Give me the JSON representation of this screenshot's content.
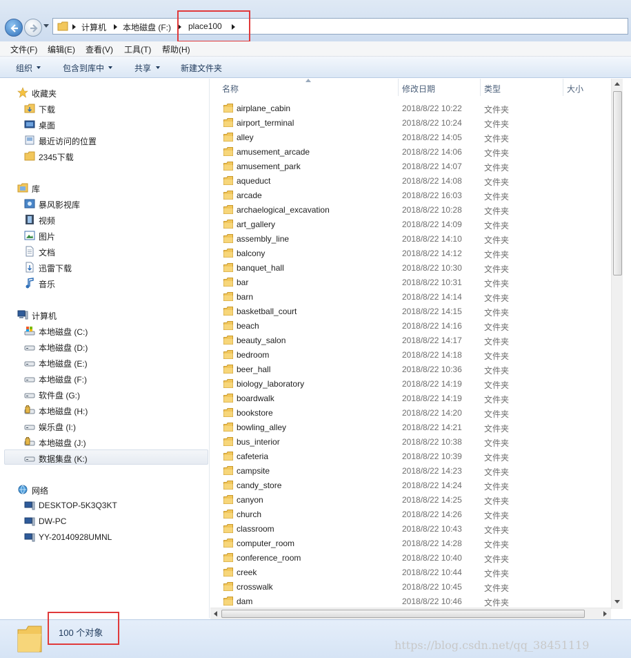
{
  "address": {
    "crumbs": [
      "计算机",
      "本地磁盘 (F:)",
      "place100"
    ]
  },
  "menu": [
    "文件(F)",
    "编辑(E)",
    "查看(V)",
    "工具(T)",
    "帮助(H)"
  ],
  "toolbar": {
    "organize": "组织",
    "include_in_library": "包含到库中",
    "share": "共享",
    "new_folder": "新建文件夹"
  },
  "nav": {
    "favorites": {
      "header": "收藏夹",
      "items": [
        "下载",
        "桌面",
        "最近访问的位置",
        "2345下载"
      ]
    },
    "libraries": {
      "header": "库",
      "items": [
        "暴风影视库",
        "视频",
        "图片",
        "文档",
        "迅雷下载",
        "音乐"
      ]
    },
    "computer": {
      "header": "计算机",
      "items": [
        "本地磁盘 (C:)",
        "本地磁盘 (D:)",
        "本地磁盘 (E:)",
        "本地磁盘 (F:)",
        "软件盘 (G:)",
        "本地磁盘 (H:)",
        "娱乐盘 (I:)",
        "本地磁盘 (J:)",
        "数据集盘 (K:)"
      ],
      "selected": "本地磁盘 (F:)"
    },
    "network": {
      "header": "网络",
      "items": [
        "DESKTOP-5K3Q3KT",
        "DW-PC",
        "YY-20140928UMNL"
      ]
    }
  },
  "columns": {
    "name": "名称",
    "date": "修改日期",
    "type": "类型",
    "size": "大小"
  },
  "files": [
    {
      "name": "airplane_cabin",
      "date": "2018/8/22 10:22",
      "type": "文件夹"
    },
    {
      "name": "airport_terminal",
      "date": "2018/8/22 10:24",
      "type": "文件夹"
    },
    {
      "name": "alley",
      "date": "2018/8/22 14:05",
      "type": "文件夹"
    },
    {
      "name": "amusement_arcade",
      "date": "2018/8/22 14:06",
      "type": "文件夹"
    },
    {
      "name": "amusement_park",
      "date": "2018/8/22 14:07",
      "type": "文件夹"
    },
    {
      "name": "aqueduct",
      "date": "2018/8/22 14:08",
      "type": "文件夹"
    },
    {
      "name": "arcade",
      "date": "2018/8/22 16:03",
      "type": "文件夹"
    },
    {
      "name": "archaelogical_excavation",
      "date": "2018/8/22 10:28",
      "type": "文件夹"
    },
    {
      "name": "art_gallery",
      "date": "2018/8/22 14:09",
      "type": "文件夹"
    },
    {
      "name": "assembly_line",
      "date": "2018/8/22 14:10",
      "type": "文件夹"
    },
    {
      "name": "balcony",
      "date": "2018/8/22 14:12",
      "type": "文件夹"
    },
    {
      "name": "banquet_hall",
      "date": "2018/8/22 10:30",
      "type": "文件夹"
    },
    {
      "name": "bar",
      "date": "2018/8/22 10:31",
      "type": "文件夹"
    },
    {
      "name": "barn",
      "date": "2018/8/22 14:14",
      "type": "文件夹"
    },
    {
      "name": "basketball_court",
      "date": "2018/8/22 14:15",
      "type": "文件夹"
    },
    {
      "name": "beach",
      "date": "2018/8/22 14:16",
      "type": "文件夹"
    },
    {
      "name": "beauty_salon",
      "date": "2018/8/22 14:17",
      "type": "文件夹"
    },
    {
      "name": "bedroom",
      "date": "2018/8/22 14:18",
      "type": "文件夹"
    },
    {
      "name": "beer_hall",
      "date": "2018/8/22 10:36",
      "type": "文件夹"
    },
    {
      "name": "biology_laboratory",
      "date": "2018/8/22 14:19",
      "type": "文件夹"
    },
    {
      "name": "boardwalk",
      "date": "2018/8/22 14:19",
      "type": "文件夹"
    },
    {
      "name": "bookstore",
      "date": "2018/8/22 14:20",
      "type": "文件夹"
    },
    {
      "name": "bowling_alley",
      "date": "2018/8/22 14:21",
      "type": "文件夹"
    },
    {
      "name": "bus_interior",
      "date": "2018/8/22 10:38",
      "type": "文件夹"
    },
    {
      "name": "cafeteria",
      "date": "2018/8/22 10:39",
      "type": "文件夹"
    },
    {
      "name": "campsite",
      "date": "2018/8/22 14:23",
      "type": "文件夹"
    },
    {
      "name": "candy_store",
      "date": "2018/8/22 14:24",
      "type": "文件夹"
    },
    {
      "name": "canyon",
      "date": "2018/8/22 14:25",
      "type": "文件夹"
    },
    {
      "name": "church",
      "date": "2018/8/22 14:26",
      "type": "文件夹"
    },
    {
      "name": "classroom",
      "date": "2018/8/22 10:43",
      "type": "文件夹"
    },
    {
      "name": "computer_room",
      "date": "2018/8/22 14:28",
      "type": "文件夹"
    },
    {
      "name": "conference_room",
      "date": "2018/8/22 10:40",
      "type": "文件夹"
    },
    {
      "name": "creek",
      "date": "2018/8/22 10:44",
      "type": "文件夹"
    },
    {
      "name": "crosswalk",
      "date": "2018/8/22 10:45",
      "type": "文件夹"
    },
    {
      "name": "dam",
      "date": "2018/8/22 10:46",
      "type": "文件夹"
    }
  ],
  "status": {
    "count": "100 个对象"
  },
  "watermark": "https://blog.csdn.net/qq_38451119",
  "colors": {
    "highlight": "#e0393a",
    "folder": "#f2c75c",
    "selection": "#e6ebf2"
  }
}
